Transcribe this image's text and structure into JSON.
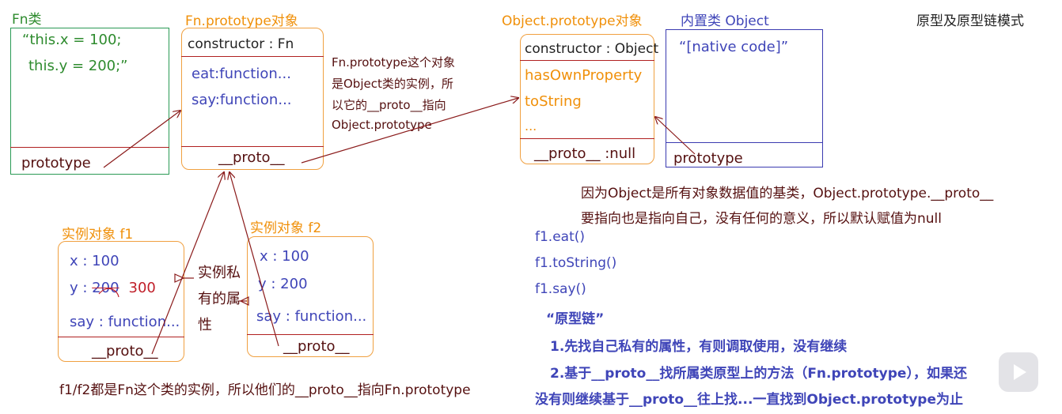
{
  "title": "原型及原型链模式",
  "fn_class": {
    "label": "Fn类",
    "code_line1": "“this.x = 100;",
    "code_line2": "this.y = 200;”",
    "prototype": "prototype"
  },
  "fn_prototype": {
    "label": "Fn.prototype对象",
    "constructor": "constructor : Fn",
    "eat": "eat:function...",
    "say": "say:function...",
    "proto": "__proto__"
  },
  "fn_prototype_note": {
    "line1": "Fn.prototype这个对象",
    "line2": "是Object类的实例，所",
    "line3": "以它的__proto__指向",
    "line4": "Object.prototype"
  },
  "object_prototype": {
    "label": "Object.prototype对象",
    "constructor": "constructor : Object",
    "has_own_property": "hasOwnProperty",
    "to_string": "toString",
    "ellipsis": "...",
    "proto": "__proto__ :null"
  },
  "object_class": {
    "label": "内置类 Object",
    "native": "“[native code]”",
    "prototype": "prototype"
  },
  "f1": {
    "label": "实例对象  f1",
    "x": "x : 100",
    "y_prefix": "y : ",
    "y_old": "200",
    "y_new": "300",
    "say": "say : function...",
    "proto": "__proto__"
  },
  "f2": {
    "label": "实例对象  f2",
    "x": "x : 100",
    "y": "y : 200",
    "say": "say : function...",
    "proto": "__proto__"
  },
  "private_note": {
    "line1": "实例私",
    "line2": "有的属",
    "line3": "性"
  },
  "bottom_note": "f1/f2都是Fn这个类的实例，所以他们的__proto__指向Fn.prototype",
  "object_note": {
    "line1": "因为Object是所有对象数据值的基类，Object.prototype.__proto__",
    "line2": "要指向也是指向自己，没有任何的意义，所以默认赋值为null"
  },
  "calls": [
    "f1.eat()",
    "f1.toString()",
    "f1.say()"
  ],
  "chain": {
    "heading": "“原型链”",
    "rule1": "1.先找自己私有的属性，有则调取使用，没有继续",
    "rule2": "2.基于__proto__找所属类原型上的方法（Fn.prototype），如果还",
    "rule3": "没有则继续基于__proto__往上找...一直找到Object.prototype为止"
  },
  "colors": {
    "orange": "#f0900a",
    "green": "#2e8b2e",
    "blue": "#3f45b8",
    "dark_red": "#551010",
    "red": "#c0202a"
  }
}
